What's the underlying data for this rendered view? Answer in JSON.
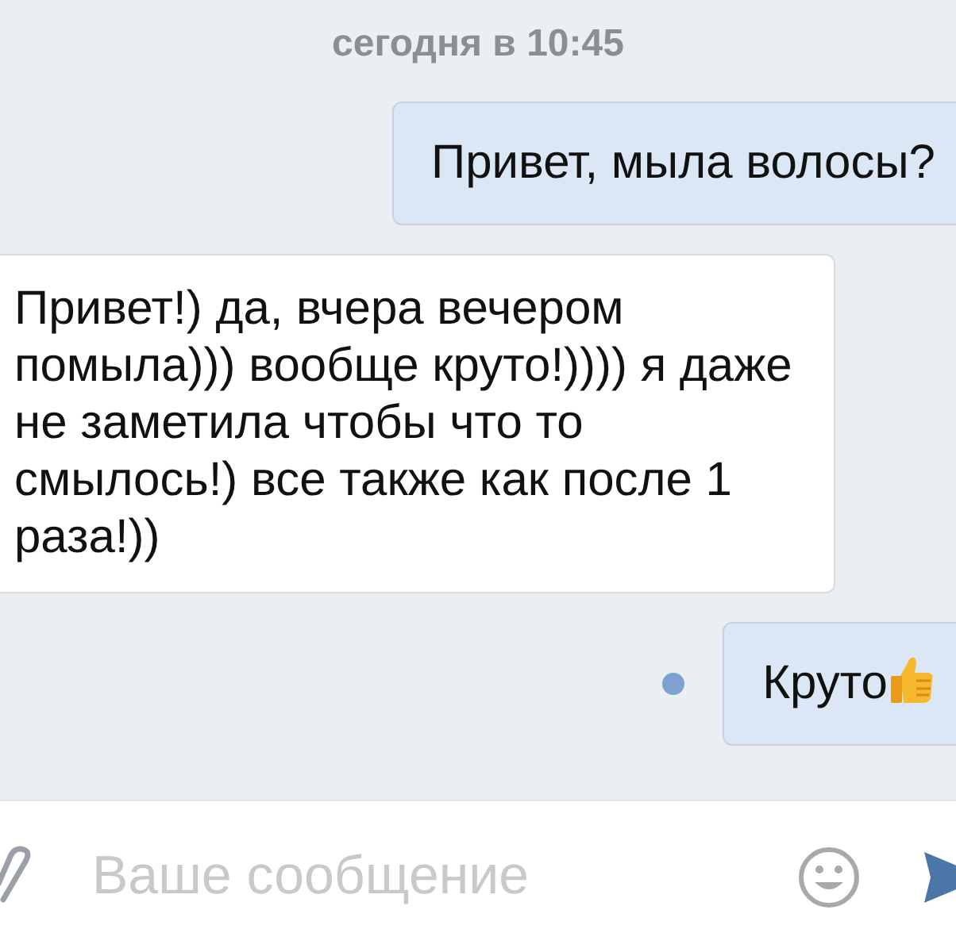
{
  "date_label": "сегодня в 10:45",
  "messages": [
    {
      "kind": "outgoing",
      "text": "Привет, мыла волосы?",
      "unread": false,
      "emoji": false
    },
    {
      "kind": "incoming",
      "text": "Привет!) да, вчера вечером помыла))) вообще круто!)))) я даже не заметила чтобы что то смылось!) все также как после 1 раза!))",
      "unread": false,
      "emoji": false
    },
    {
      "kind": "outgoing",
      "text": "Круто",
      "unread": true,
      "emoji": true
    }
  ],
  "composer": {
    "placeholder": "Ваше сообщение"
  }
}
